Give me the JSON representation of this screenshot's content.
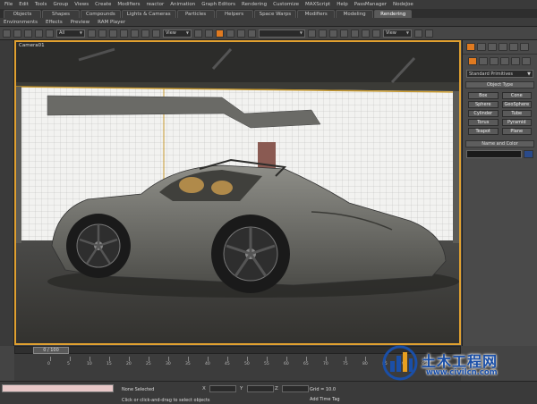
{
  "menu": [
    "File",
    "Edit",
    "Tools",
    "Group",
    "Views",
    "Create",
    "Modifiers",
    "reactor",
    "Animation",
    "Graph Editors",
    "Rendering",
    "Customize",
    "MAXScript",
    "Help",
    "PassManager",
    "NodeJoe"
  ],
  "tabs": [
    {
      "label": "Objects",
      "active": false
    },
    {
      "label": "Shapes",
      "active": false
    },
    {
      "label": "Compounds",
      "active": false
    },
    {
      "label": "Lights & Cameras",
      "active": false
    },
    {
      "label": "Particles",
      "active": false
    },
    {
      "label": "Helpers",
      "active": false
    },
    {
      "label": "Space Warps",
      "active": false
    },
    {
      "label": "Modifiers",
      "active": false
    },
    {
      "label": "Modeling",
      "active": false
    },
    {
      "label": "Rendering",
      "active": true
    }
  ],
  "subtoolbar": [
    "Environments",
    "Effects",
    "Preview",
    "RAM Player"
  ],
  "toolbar": {
    "filter": "All",
    "refcoord": "View",
    "selset": "",
    "refcoord2": "View"
  },
  "viewport": {
    "label": "Camera01"
  },
  "command_panel": {
    "category": "Standard Primitives",
    "object_type_title": "Object Type",
    "object_buttons": [
      "Box",
      "Cone",
      "Sphere",
      "GeoSphere",
      "Cylinder",
      "Tube",
      "Torus",
      "Pyramid",
      "Teapot",
      "Plane"
    ],
    "name_color_title": "Name and Color",
    "name_value": ""
  },
  "time_slider": {
    "current": 0,
    "total": 100,
    "label": "0 / 100"
  },
  "track_ticks": [
    "0",
    "5",
    "10",
    "15",
    "20",
    "25",
    "30",
    "35",
    "40",
    "45",
    "50",
    "55",
    "60",
    "65",
    "70",
    "75",
    "80",
    "85",
    "90",
    "95",
    "100"
  ],
  "status": {
    "selection": "None Selected",
    "prompt": "Click or click-and-drag to select objects",
    "x_label": "X",
    "y_label": "Y",
    "z_label": "Z",
    "grid": "Grid = 10.0",
    "add_time_tag": "Add Time Tag"
  },
  "watermark": {
    "title": "土木工程网",
    "url": "www.civilcn.com"
  },
  "colors": {
    "viewport_border": "#e0a030",
    "active_tab": "#5a5a5a",
    "watermark": "#1a4fa8",
    "accent": "#e07a20"
  }
}
